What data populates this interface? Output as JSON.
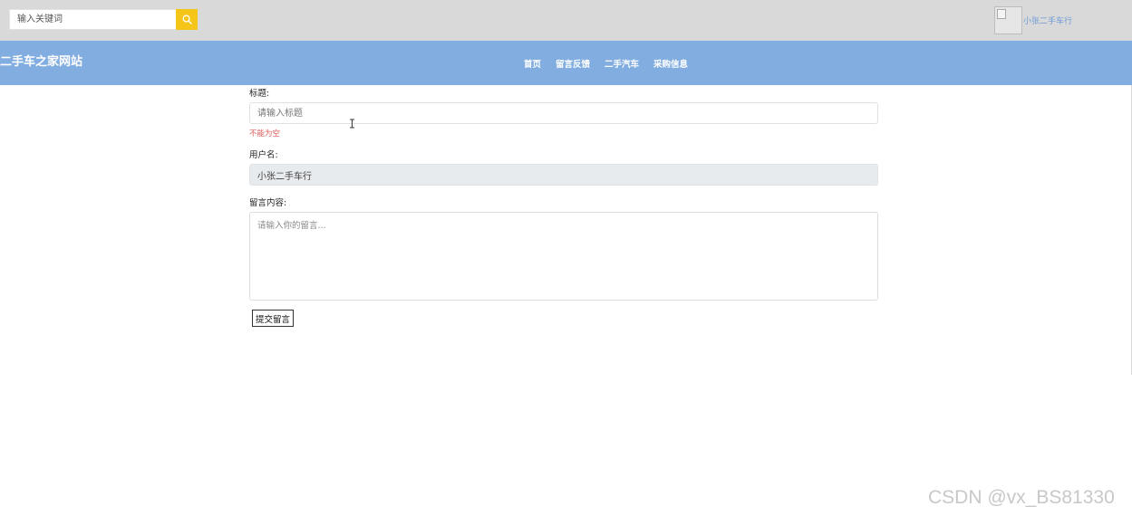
{
  "search": {
    "placeholder": "输入关键词",
    "icon": "search-icon",
    "button_color": "#f5c518"
  },
  "user": {
    "name": "小张二手车行",
    "avatar_icon": "broken-image-icon"
  },
  "header": {
    "site_title": "二手车之家网站",
    "bar_color": "#82ade0"
  },
  "nav": {
    "items": [
      {
        "label": "首页"
      },
      {
        "label": "留言反馈"
      },
      {
        "label": "二手汽车"
      },
      {
        "label": "采购信息"
      }
    ]
  },
  "form": {
    "title_label": "标题:",
    "title_placeholder": "请输入标题",
    "title_error": "不能为空",
    "username_label": "用户名:",
    "username_value": "小张二手车行",
    "message_label": "留言内容:",
    "message_placeholder": "请输入你的留言...",
    "submit_label": "提交留言"
  },
  "watermark": "CSDN @vx_BS81330"
}
